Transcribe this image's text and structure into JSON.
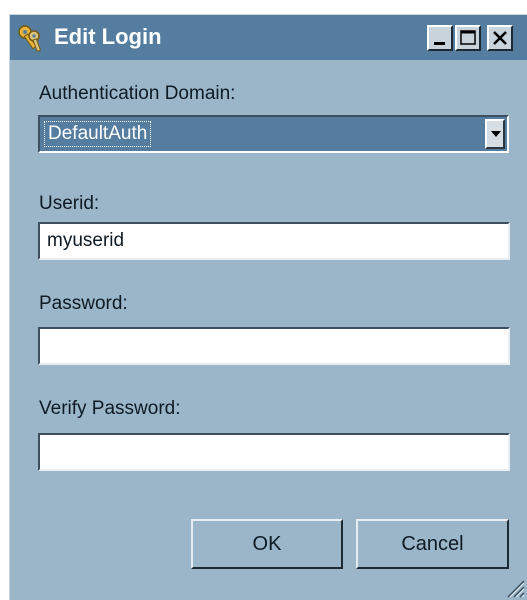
{
  "window": {
    "title": "Edit Login",
    "title_icon": "keys-icon",
    "controls": [
      "minimize-icon",
      "maximize-icon",
      "close-icon"
    ]
  },
  "form": {
    "domain_label": "Authentication Domain:",
    "domain_value": "DefaultAuth",
    "userid_label": "Userid:",
    "userid_value": "myuserid",
    "password_label": "Password:",
    "password_value": "",
    "verify_label": "Verify Password:",
    "verify_value": ""
  },
  "buttons": {
    "ok": "OK",
    "cancel": "Cancel"
  },
  "colors": {
    "titlebar": "#547d9f",
    "window_bg": "#9bb6c9",
    "selected_field": "#547d9f"
  }
}
